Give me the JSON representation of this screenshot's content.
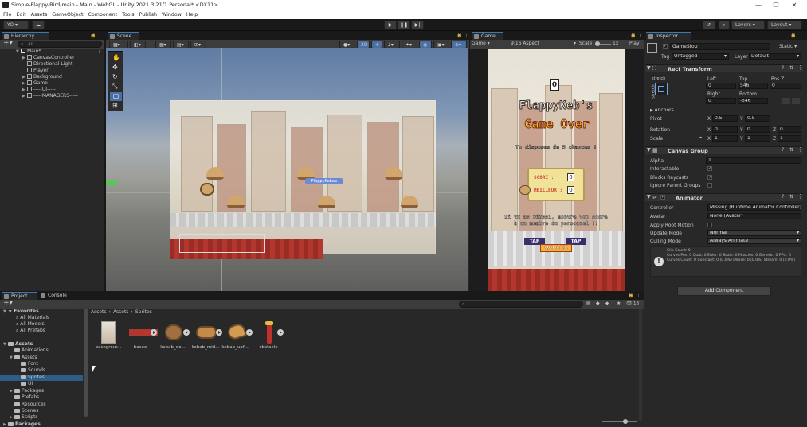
{
  "window": {
    "title": "Simple-Flappy-Bird-main - Main - WebGL - Unity 2021.3.21f1 Personal* <DX11>",
    "controls": [
      "—",
      "❐",
      "✕"
    ]
  },
  "menu": [
    "File",
    "Edit",
    "Assets",
    "GameObject",
    "Component",
    "Tools",
    "Publish",
    "Window",
    "Help"
  ],
  "toolbar": {
    "account": "YO ▾",
    "cloud": "☁",
    "layers": "Layers",
    "layout": "Layout",
    "undo": "↺",
    "search": "⌕"
  },
  "hierarchy": {
    "tab": "Hierarchy",
    "search_placeholder": "All",
    "scene": "Main*",
    "items": [
      "CanvasController",
      "Directional Light",
      "Player",
      "Background",
      "Game",
      "-----UI-----",
      "-----MANAGERS-----"
    ]
  },
  "scene": {
    "tab": "Scene",
    "mode_2d": "2D",
    "bird_label": "FlappyKebab"
  },
  "game": {
    "tab": "Game",
    "display": "Game",
    "aspect": "9:16 Aspect",
    "scale_label": "Scale",
    "scale_value": "1x",
    "play_label": "Play",
    "score_counter": "0",
    "title_line1": "FlappyKeb's",
    "title_line2": "Game Over",
    "subtitle": "Tu disposes de 5 chances !",
    "score_label": "SCORE :",
    "score_value": "0",
    "best_label": "MEILLEUR :",
    "best_value": "0",
    "message": "Si tu as réussi, montre ton score à un membre du personnel !!",
    "tap_left": "TAP",
    "tap_right": "TAP",
    "quit": "QUITTER"
  },
  "inspector": {
    "tab": "Inspector",
    "object_name": "GameStop",
    "static_label": "Static",
    "tag_label": "Tag",
    "tag_value": "Untagged",
    "layer_label": "Layer",
    "layer_value": "Default",
    "rect_transform": {
      "title": "Rect Transform",
      "anchor_preset_x": "stretch",
      "anchor_preset_y": "stretch",
      "left_label": "Left",
      "top_label": "Top",
      "posz_label": "Pos Z",
      "left": "0",
      "top": "546",
      "posz": "0",
      "right_label": "Right",
      "bottom_label": "Bottom",
      "right": "0",
      "bottom": "-546",
      "anchors_label": "Anchors",
      "pivot_label": "Pivot",
      "pivot_x": "0.5",
      "pivot_y": "0.5",
      "rotation_label": "Rotation",
      "rot_x": "0",
      "rot_y": "0",
      "rot_z": "0",
      "scale_label": "Scale",
      "scale_x": "1",
      "scale_y": "1",
      "scale_z": "1"
    },
    "canvas_group": {
      "title": "Canvas Group",
      "alpha_label": "Alpha",
      "alpha": "1",
      "interactable_label": "Interactable",
      "blocks_label": "Blocks Raycasts",
      "ignore_label": "Ignore Parent Groups"
    },
    "animator": {
      "title": "Animator",
      "controller_label": "Controller",
      "controller_value": "Missing (Runtime Animator Controller)",
      "avatar_label": "Avatar",
      "avatar_value": "None (Avatar)",
      "root_motion_label": "Apply Root Motion",
      "update_label": "Update Mode",
      "update_value": "Normal",
      "culling_label": "Culling Mode",
      "culling_value": "Always Animate",
      "info": "Clip Count: 0\nCurves Pos: 0 Quat: 0 Euler: 0 Scale: 0 Muscles: 0 Generic: 0 PPtr: 0\nCurves Count: 0 Constant: 0 (0.0%) Dense: 0 (0.0%) Stream: 0 (0.0%)"
    },
    "add_component": "Add Component"
  },
  "project": {
    "tab_project": "Project",
    "tab_console": "Console",
    "breadcrumb": [
      "Assets",
      "Assets",
      "Sprites"
    ],
    "hidden_count": "18",
    "favorites_label": "Favorites",
    "favorites": [
      "All Materials",
      "All Models",
      "All Prefabs"
    ],
    "assets_label": "Assets",
    "tree": [
      {
        "label": "Animations",
        "depth": 1
      },
      {
        "label": "Assets",
        "depth": 1
      },
      {
        "label": "Font",
        "depth": 2
      },
      {
        "label": "Sounds",
        "depth": 2
      },
      {
        "label": "Sprites",
        "depth": 2,
        "selected": true
      },
      {
        "label": "UI",
        "depth": 2
      },
      {
        "label": "Packages",
        "depth": 1
      },
      {
        "label": "Prefabs",
        "depth": 1
      },
      {
        "label": "Resources",
        "depth": 1
      },
      {
        "label": "Scenes",
        "depth": 1
      },
      {
        "label": "Scripts",
        "depth": 1
      }
    ],
    "packages_label": "Packages",
    "assets": [
      "backgrour...",
      "basee",
      "kebab_do...",
      "kebab_mid...",
      "kebab_upfl...",
      "obstacle"
    ]
  }
}
